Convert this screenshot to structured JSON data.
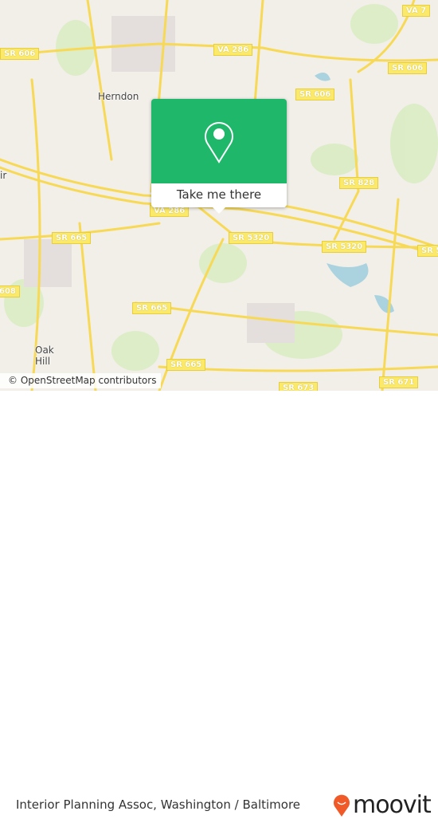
{
  "map": {
    "places": [
      {
        "label": "Herndon"
      },
      {
        "label": "Oak Hill"
      },
      {
        "label": "ir"
      }
    ],
    "shields": [
      "SR 606",
      "VA 7",
      "VA 286",
      "SR 606",
      "SR 606",
      "SR 828",
      "SR 5320",
      "SR 5320",
      "SR 665",
      "SR 665",
      "SR 665",
      "SR 673",
      "SR 671",
      "VA 286",
      "608",
      "SR 5"
    ],
    "attribution": "© OpenStreetMap contributors"
  },
  "popup": {
    "icon": "map-pin-icon",
    "button_label": "Take me there",
    "color": "#1fb86b"
  },
  "footer": {
    "title": "Interior Planning Assoc, Washington / Baltimore",
    "logo_text": "moovit",
    "logo_color": "#f05a28"
  }
}
